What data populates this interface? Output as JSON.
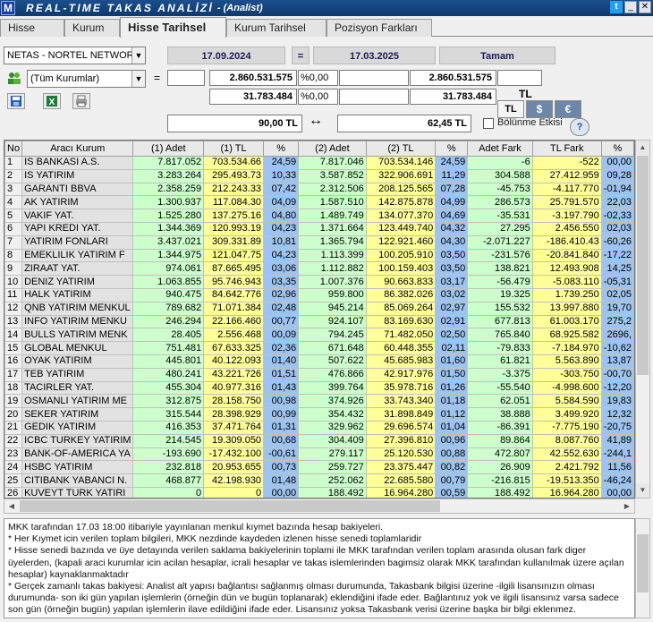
{
  "window": {
    "logo": "M",
    "title": "REAL-TIME TAKAS ANALİZİ",
    "subtitle": "- (Analist)"
  },
  "tabs": [
    {
      "label": "Hisse"
    },
    {
      "label": "Kurum"
    },
    {
      "label": "Hisse Tarihsel",
      "active": true
    },
    {
      "label": "Kurum Tarihsel"
    },
    {
      "label": "Pozisyon Farkları"
    }
  ],
  "filters": {
    "stock": "NETAS - NORTEL NETWORKS",
    "date1": "17.09.2024",
    "equals": "=",
    "date2": "17.03.2025",
    "ok": "Tamam",
    "institution": "(Tüm Kurumlar)",
    "eq2": "=",
    "lot1": "2.860.531.575",
    "lotpct": "%0,00",
    "lot2": "2.860.531.575",
    "tl1": "31.783.484",
    "tlpct": "%0,00",
    "tl2": "31.783.484",
    "currency_label": "TL",
    "cur_tl": "TL",
    "cur_usd": "$",
    "cur_eur": "€",
    "price1": "90,00 TL",
    "swap": "↔",
    "price2": "62,45 TL",
    "split_label": "Bölünme Etkisi",
    "help": "?"
  },
  "grid": {
    "headers": [
      "No",
      "Aracı Kurum",
      "(1) Adet",
      "(1) TL",
      "%",
      "(2) Adet",
      "(2) TL",
      "%",
      "Adet Fark",
      "TL Fark",
      "%"
    ],
    "rows": [
      [
        "1",
        "IS BANKASI A.S.",
        "7.817.052",
        "703.534.66",
        "24,59",
        "7.817.046",
        "703.534.146",
        "24,59",
        "-6",
        "-522",
        "00,00"
      ],
      [
        "2",
        "IS YATIRIM",
        "3.283.264",
        "295.493.73",
        "10,33",
        "3.587.852",
        "322.906.691",
        "11,29",
        "304.588",
        "27.412.959",
        "09,28"
      ],
      [
        "3",
        "GARANTI BBVA",
        "2.358.259",
        "212.243.33",
        "07,42",
        "2.312.506",
        "208.125.565",
        "07,28",
        "-45.753",
        "-4.117.770",
        "-01,94"
      ],
      [
        "4",
        "AK YATIRIM",
        "1.300.937",
        "117.084.30",
        "04,09",
        "1.587.510",
        "142.875.878",
        "04,99",
        "286.573",
        "25.791.570",
        "22,03"
      ],
      [
        "5",
        "VAKIF YAT.",
        "1.525.280",
        "137.275.16",
        "04,80",
        "1.489.749",
        "134.077.370",
        "04,69",
        "-35.531",
        "-3.197.790",
        "-02,33"
      ],
      [
        "6",
        "YAPI KREDI YAT.",
        "1.344.369",
        "120.993.19",
        "04,23",
        "1.371.664",
        "123.449.740",
        "04,32",
        "27.295",
        "2.456.550",
        "02,03"
      ],
      [
        "7",
        "YATIRIM FONLARI",
        "3.437.021",
        "309.331.89",
        "10,81",
        "1.365.794",
        "122.921.460",
        "04,30",
        "-2.071.227",
        "-186.410.43",
        "-60,26"
      ],
      [
        "8",
        "EMEKLILIK YATIRIM F",
        "1.344.975",
        "121.047.75",
        "04,23",
        "1.113.399",
        "100.205.910",
        "03,50",
        "-231.576",
        "-20.841.840",
        "-17,22"
      ],
      [
        "9",
        "ZIRAAT YAT.",
        "974.061",
        "87.665.495",
        "03,06",
        "1.112.882",
        "100.159.403",
        "03,50",
        "138.821",
        "12.493.908",
        "14,25"
      ],
      [
        "10",
        "DENIZ YATIRIM",
        "1.063.855",
        "95.746.943",
        "03,35",
        "1.007.376",
        "90.663.833",
        "03,17",
        "-56.479",
        "-5.083.110",
        "-05,31"
      ],
      [
        "11",
        "HALK YATIRIM",
        "940.475",
        "84.642.776",
        "02,96",
        "959.800",
        "86.382.026",
        "03,02",
        "19.325",
        "1.739.250",
        "02,05"
      ],
      [
        "12",
        "QNB YATIRIM MENKUL",
        "789.682",
        "71.071.384",
        "02,48",
        "945.214",
        "85.069.264",
        "02,97",
        "155.532",
        "13.997.880",
        "19,70"
      ],
      [
        "13",
        "INFO YATIRIM MENKU",
        "246.294",
        "22.166.460",
        "00,77",
        "924.107",
        "83.169.630",
        "02,91",
        "677.813",
        "61.003.170",
        "275,2"
      ],
      [
        "14",
        "BULLS YATIRIM MENK",
        "28.405",
        "2.556.468",
        "00,09",
        "794.245",
        "71.482.050",
        "02,50",
        "765.840",
        "68.925.582",
        "2696,"
      ],
      [
        "15",
        "GLOBAL MENKUL",
        "751.481",
        "67.633.325",
        "02,36",
        "671.648",
        "60.448.355",
        "02,11",
        "-79.833",
        "-7.184.970",
        "-10,62"
      ],
      [
        "16",
        "OYAK YATIRIM",
        "445.801",
        "40.122.093",
        "01,40",
        "507.622",
        "45.685.983",
        "01,60",
        "61.821",
        "5.563.890",
        "13,87"
      ],
      [
        "17",
        "TEB YATIRIM",
        "480.241",
        "43.221.726",
        "01,51",
        "476.866",
        "42.917.976",
        "01,50",
        "-3.375",
        "-303.750",
        "-00,70"
      ],
      [
        "18",
        "TACIRLER YAT.",
        "455.304",
        "40.977.316",
        "01,43",
        "399.764",
        "35.978.716",
        "01,26",
        "-55.540",
        "-4.998.600",
        "-12,20"
      ],
      [
        "19",
        "OSMANLI YATIRIM ME",
        "312.875",
        "28.158.750",
        "00,98",
        "374.926",
        "33.743.340",
        "01,18",
        "62.051",
        "5.584.590",
        "19,83"
      ],
      [
        "20",
        "SEKER YATIRIM",
        "315.544",
        "28.398.929",
        "00,99",
        "354.432",
        "31.898.849",
        "01,12",
        "38.888",
        "3.499.920",
        "12,32"
      ],
      [
        "21",
        "GEDIK YATIRIM",
        "416.353",
        "37.471.764",
        "01,31",
        "329.962",
        "29.696.574",
        "01,04",
        "-86.391",
        "-7.775.190",
        "-20,75"
      ],
      [
        "22",
        "ICBC TURKEY YATIRIM",
        "214.545",
        "19.309.050",
        "00,68",
        "304.409",
        "27.396.810",
        "00,96",
        "89.864",
        "8.087.760",
        "41,89"
      ],
      [
        "23",
        "BANK-OF-AMERICA YA",
        "-193.690",
        "-17.432.100",
        "-00,61",
        "279.117",
        "25.120.530",
        "00,88",
        "472.807",
        "42.552.630",
        "-244,1"
      ],
      [
        "24",
        "HSBC YATIRIM",
        "232.818",
        "20.953.655",
        "00,73",
        "259.727",
        "23.375.447",
        "00,82",
        "26.909",
        "2.421.792",
        "11,56"
      ],
      [
        "25",
        "CITIBANK YABANCI N.",
        "468.877",
        "42.198.930",
        "01,48",
        "252.062",
        "22.685.580",
        "00,79",
        "-216.815",
        "-19.513.350",
        "-46,24"
      ],
      [
        "26",
        "KUVEYT TURK YATIRI",
        "0",
        "0",
        "00,00",
        "188.492",
        "16.964.280",
        "00,59",
        "188.492",
        "16.964.280",
        "00,00"
      ]
    ]
  },
  "notes": [
    "MKK tarafından 17.03 18:00 itibariyle yayınlanan menkul kıymet bazında hesap bakiyeleri.",
    "* Her Kıymet icin verilen toplam bilgileri, MKK nezdinde kaydeden izlenen hisse senedi toplamlaridir",
    "* Hisse senedi bazında ve üye detayında verilen saklama bakiyelerinin toplami ile MKK tarafından verilen toplam arasında olusan fark diger üyelerden, (kapali araci kurumlar icin acilan hesaplar, icrali hesaplar ve takas islemlerinden bagimsiz olarak MKK tarafından kullanılmak üzere açılan hesaplar) kaynaklanmaktadır",
    "* Gerçek zamanlı takas bakiyesi: Analist alt yapısı bağlantısı sağlanmış olması durumunda, Takasbank bilgisi üzerine -ilgili lisansınızın olması durumunda- son iki gün yapılan işlemlerin (örneğin dün ve bugün toplanarak) eklendiğini ifade eder. Bağlantınız yok ve ilgili lisansınız varsa sadece son gün (örneğin bugün) yapılan işlemlerin ilave edildiğini ifade eder. Lisansınız yoksa Takasbank verisi üzerine başka bir bilgi eklenmez."
  ]
}
